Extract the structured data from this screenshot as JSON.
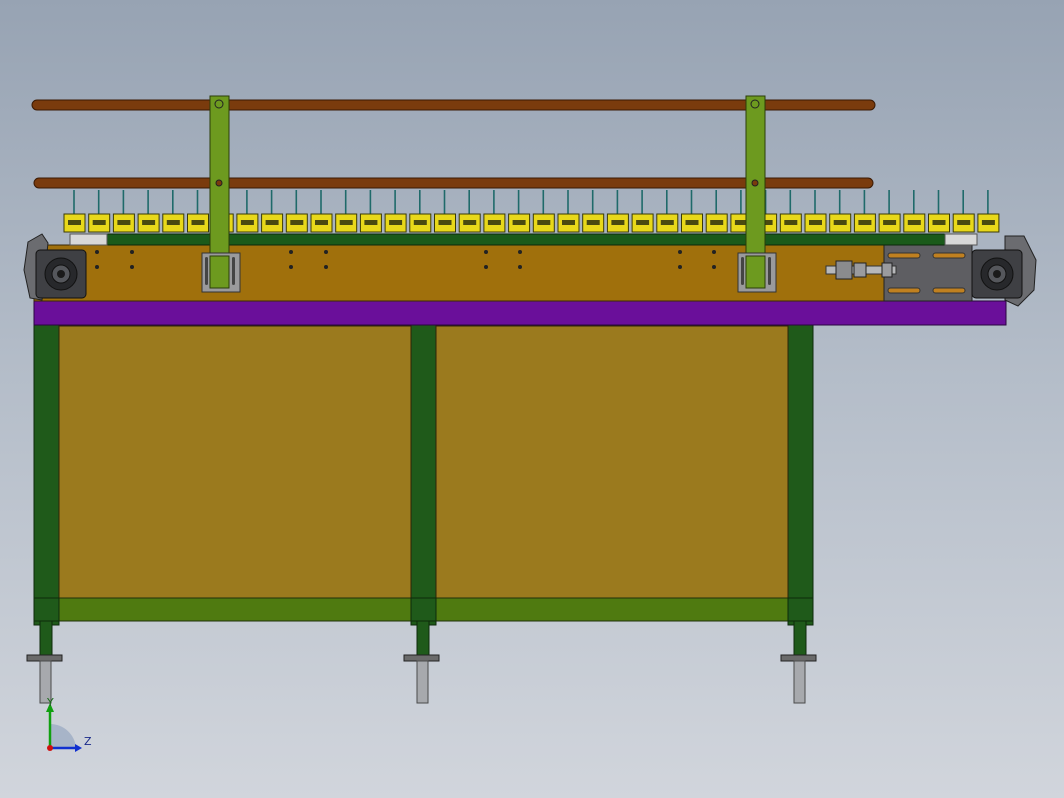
{
  "viewport": {
    "view": "front",
    "background_top": "#97a3b3",
    "background_bottom": "#d1d5dc"
  },
  "colors": {
    "rail": "#7a3b0d",
    "hanger": "#6d9a1f",
    "frame_green": "#1f5a1a",
    "crossbar_green": "#4f7a10",
    "panel": "#9b7a1e",
    "side_plate": "#a0700c",
    "belt_purple": "#6a0f9a",
    "carrier_yellow": "#e8d81a",
    "motor_plate": "#5e5e62"
  },
  "assembly": {
    "rails": [
      "top-guide-rail",
      "lower-guide-rail"
    ],
    "hanger_count": 2,
    "carrier_count": 38,
    "leg_count": 3,
    "drive_units": [
      "left-drive-sprocket",
      "right-drive-sprocket"
    ]
  },
  "triad": {
    "y_label": "Y",
    "z_label": "Z",
    "x_color": "#d01010",
    "y_color": "#10a010",
    "z_color": "#1030d0"
  }
}
